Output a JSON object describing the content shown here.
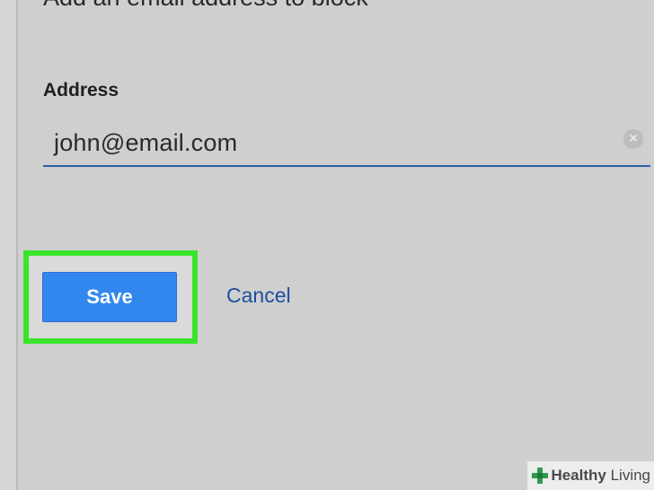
{
  "form": {
    "heading": "Add an email address to block",
    "address_label": "Address",
    "address_value": "john@email.com"
  },
  "actions": {
    "save_label": "Save",
    "cancel_label": "Cancel"
  },
  "watermark": {
    "brand_bold": "Healthy",
    "brand_rest": " Living"
  },
  "colors": {
    "highlight": "#39e42a",
    "save_button": "#3287ef",
    "cancel_link": "#1f4f9e",
    "input_underline": "#2b5fa8"
  }
}
